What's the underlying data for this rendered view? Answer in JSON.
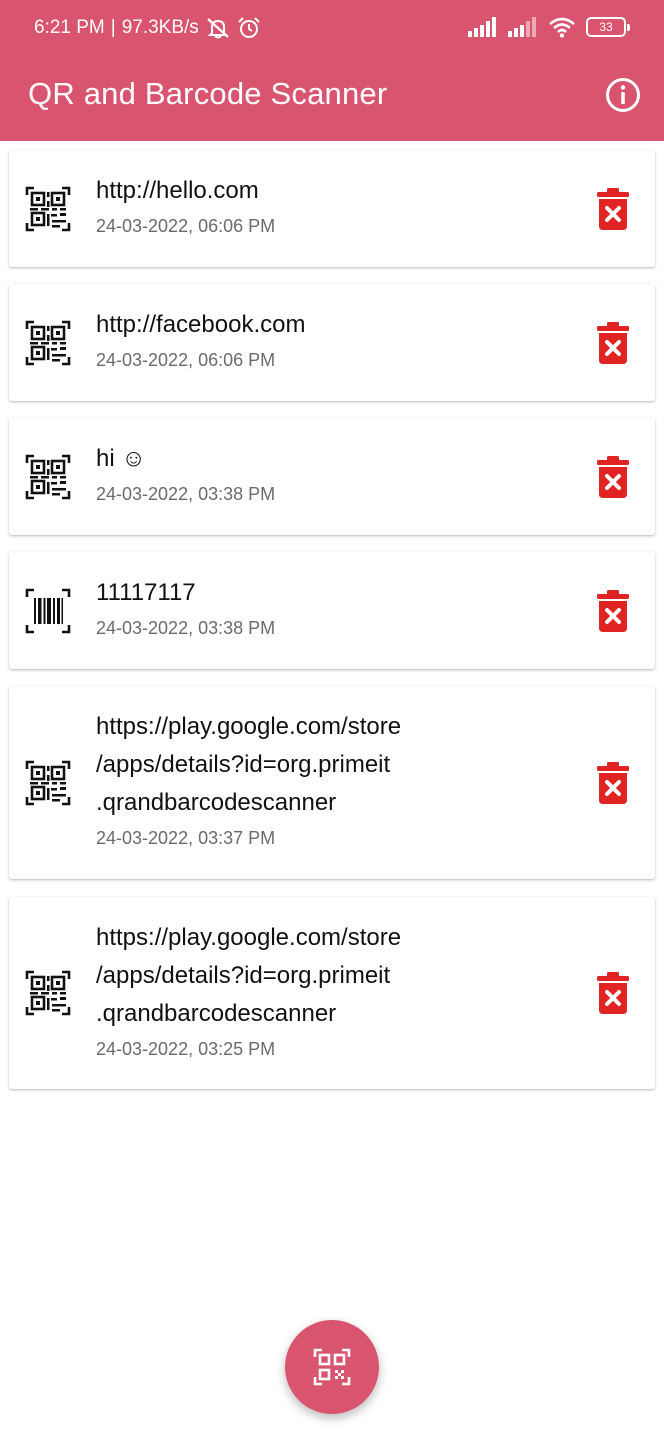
{
  "status_bar": {
    "time": "6:21 PM",
    "network_speed": "97.3KB/s",
    "battery": "33"
  },
  "app_bar": {
    "title": "QR and Barcode Scanner",
    "info_icon": "info-icon"
  },
  "history": [
    {
      "kind": "qr",
      "text": "http://hello.com",
      "date": "24-03-2022, 06:06 PM"
    },
    {
      "kind": "qr",
      "text": "http://facebook.com",
      "date": "24-03-2022, 06:06 PM"
    },
    {
      "kind": "qr",
      "text": "hi ☺",
      "date": "24-03-2022, 03:38 PM"
    },
    {
      "kind": "barcode",
      "text": "11117117",
      "date": "24-03-2022, 03:38 PM"
    },
    {
      "kind": "qr",
      "text": "https://play.google.com/store\n/apps/details?id=org.primeit\n.qrandbarcodescanner",
      "date": "24-03-2022, 03:37 PM"
    },
    {
      "kind": "qr",
      "text": "https://play.google.com/store\n/apps/details?id=org.primeit\n.qrandbarcodescanner",
      "date": "24-03-2022, 03:25 PM"
    }
  ],
  "colors": {
    "primary": "#d9546f",
    "delete": "#e02424"
  },
  "fab": {
    "icon": "qr-scan-icon"
  }
}
